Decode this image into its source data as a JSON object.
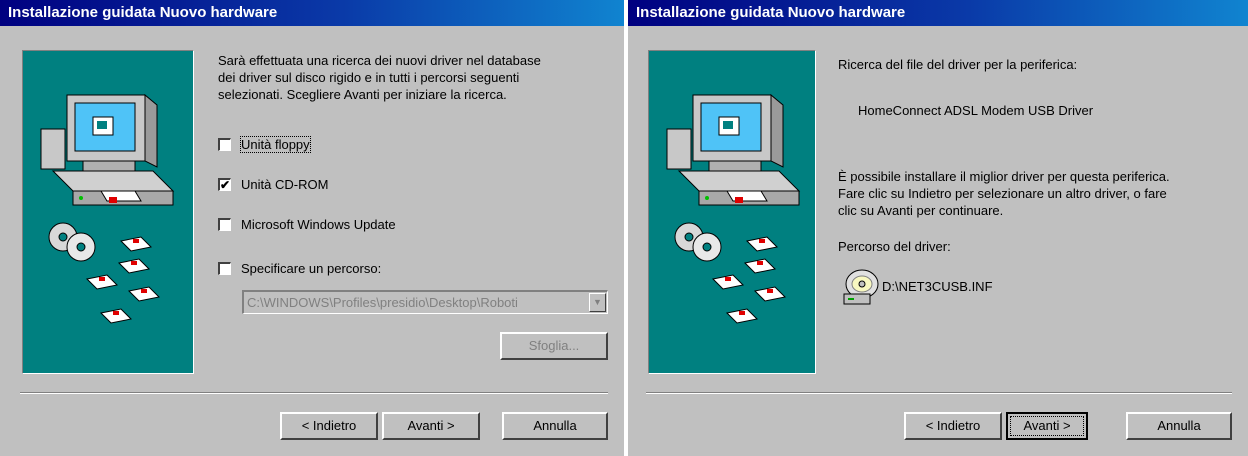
{
  "left_dialog": {
    "title": "Installazione guidata Nuovo hardware",
    "description": "Sarà effettuata una ricerca dei nuovi driver nel database\ndei driver sul disco rigido e in tutti i percorsi seguenti\nselezionati. Scegliere Avanti per iniziare la ricerca.",
    "options": [
      {
        "label": "Unità floppy",
        "checked": false
      },
      {
        "label": "Unità CD-ROM",
        "checked": true
      },
      {
        "label": "Microsoft Windows Update",
        "checked": false
      },
      {
        "label": "Specificare un percorso:",
        "checked": false
      }
    ],
    "path_value": "C:\\WINDOWS\\Profiles\\presidio\\Desktop\\Roboti",
    "browse_label": "Sfoglia...",
    "back_label": "< Indietro",
    "next_label": "Avanti >",
    "cancel_label": "Annulla"
  },
  "right_dialog": {
    "title": "Installazione guidata Nuovo hardware",
    "search_text": "Ricerca del file del driver per la periferica:",
    "device_name": "HomeConnect ADSL Modem USB Driver",
    "info_text": "È possibile installare il miglior driver per questa periferica.\nFare clic su Indietro per selezionare un altro driver, o fare\nclic su Avanti per continuare.",
    "driver_path_label": "Percorso del driver:",
    "driver_file": "D:\\NET3CUSB.INF",
    "back_label": "< Indietro",
    "next_label": "Avanti >",
    "cancel_label": "Annulla"
  },
  "icons": {
    "wizard_art": "computer-cd-floppy-art",
    "cd_icon": "cd-drive-icon",
    "checkmark": "✔",
    "dropdown": "▼"
  }
}
